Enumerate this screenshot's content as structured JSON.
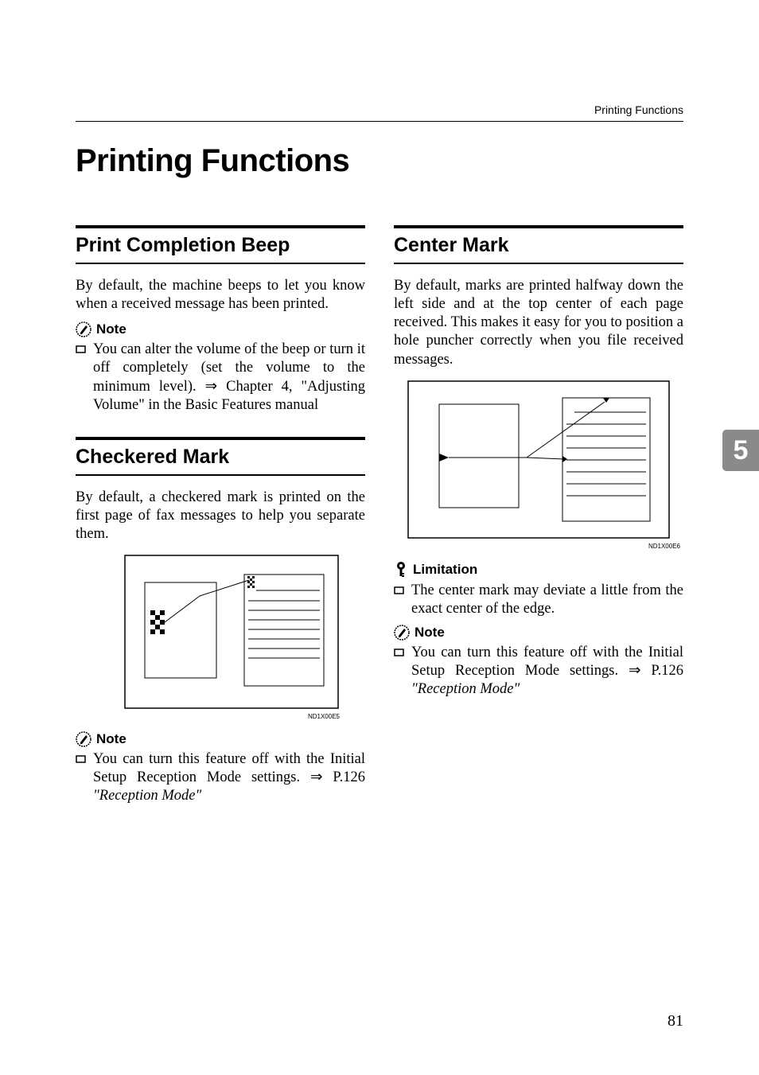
{
  "header": {
    "label": "Printing Functions"
  },
  "title": "Printing Functions",
  "tab": "5",
  "pageNumber": "81",
  "labels": {
    "note": "Note",
    "limitation": "Limitation"
  },
  "figcap": {
    "checkered": "ND1X00E5",
    "center": "ND1X00E6"
  },
  "col1": {
    "s1": {
      "heading": "Print Completion Beep",
      "body": "By default, the machine beeps to let you know when a received message has been printed.",
      "note1_a": "You can alter the volume of the beep or turn it off completely (set the volume to the minimum level). ",
      "note1_b": " Chapter 4, \"Adjusting Volume\" in the Basic Features manual"
    },
    "s2": {
      "heading": "Checkered Mark",
      "body": "By default, a checkered mark is printed on the first page of fax messages to help you separate them.",
      "note1_a": "You can turn this feature off with the Initial Setup Reception Mode settings. ",
      "note1_b": " P.126 ",
      "note1_c": "\"Reception Mode\""
    }
  },
  "col2": {
    "s1": {
      "heading": "Center Mark",
      "body": "By default, marks are printed halfway down the left side and at the top center of each page received. This makes it easy for you to position a hole puncher correctly when you file received messages.",
      "limit1": "The center mark may deviate a little from the exact center of the edge.",
      "note1_a": "You can turn this feature off with the Initial Setup Reception Mode settings. ",
      "note1_b": " P.126 ",
      "note1_c": "\"Reception Mode\""
    }
  }
}
